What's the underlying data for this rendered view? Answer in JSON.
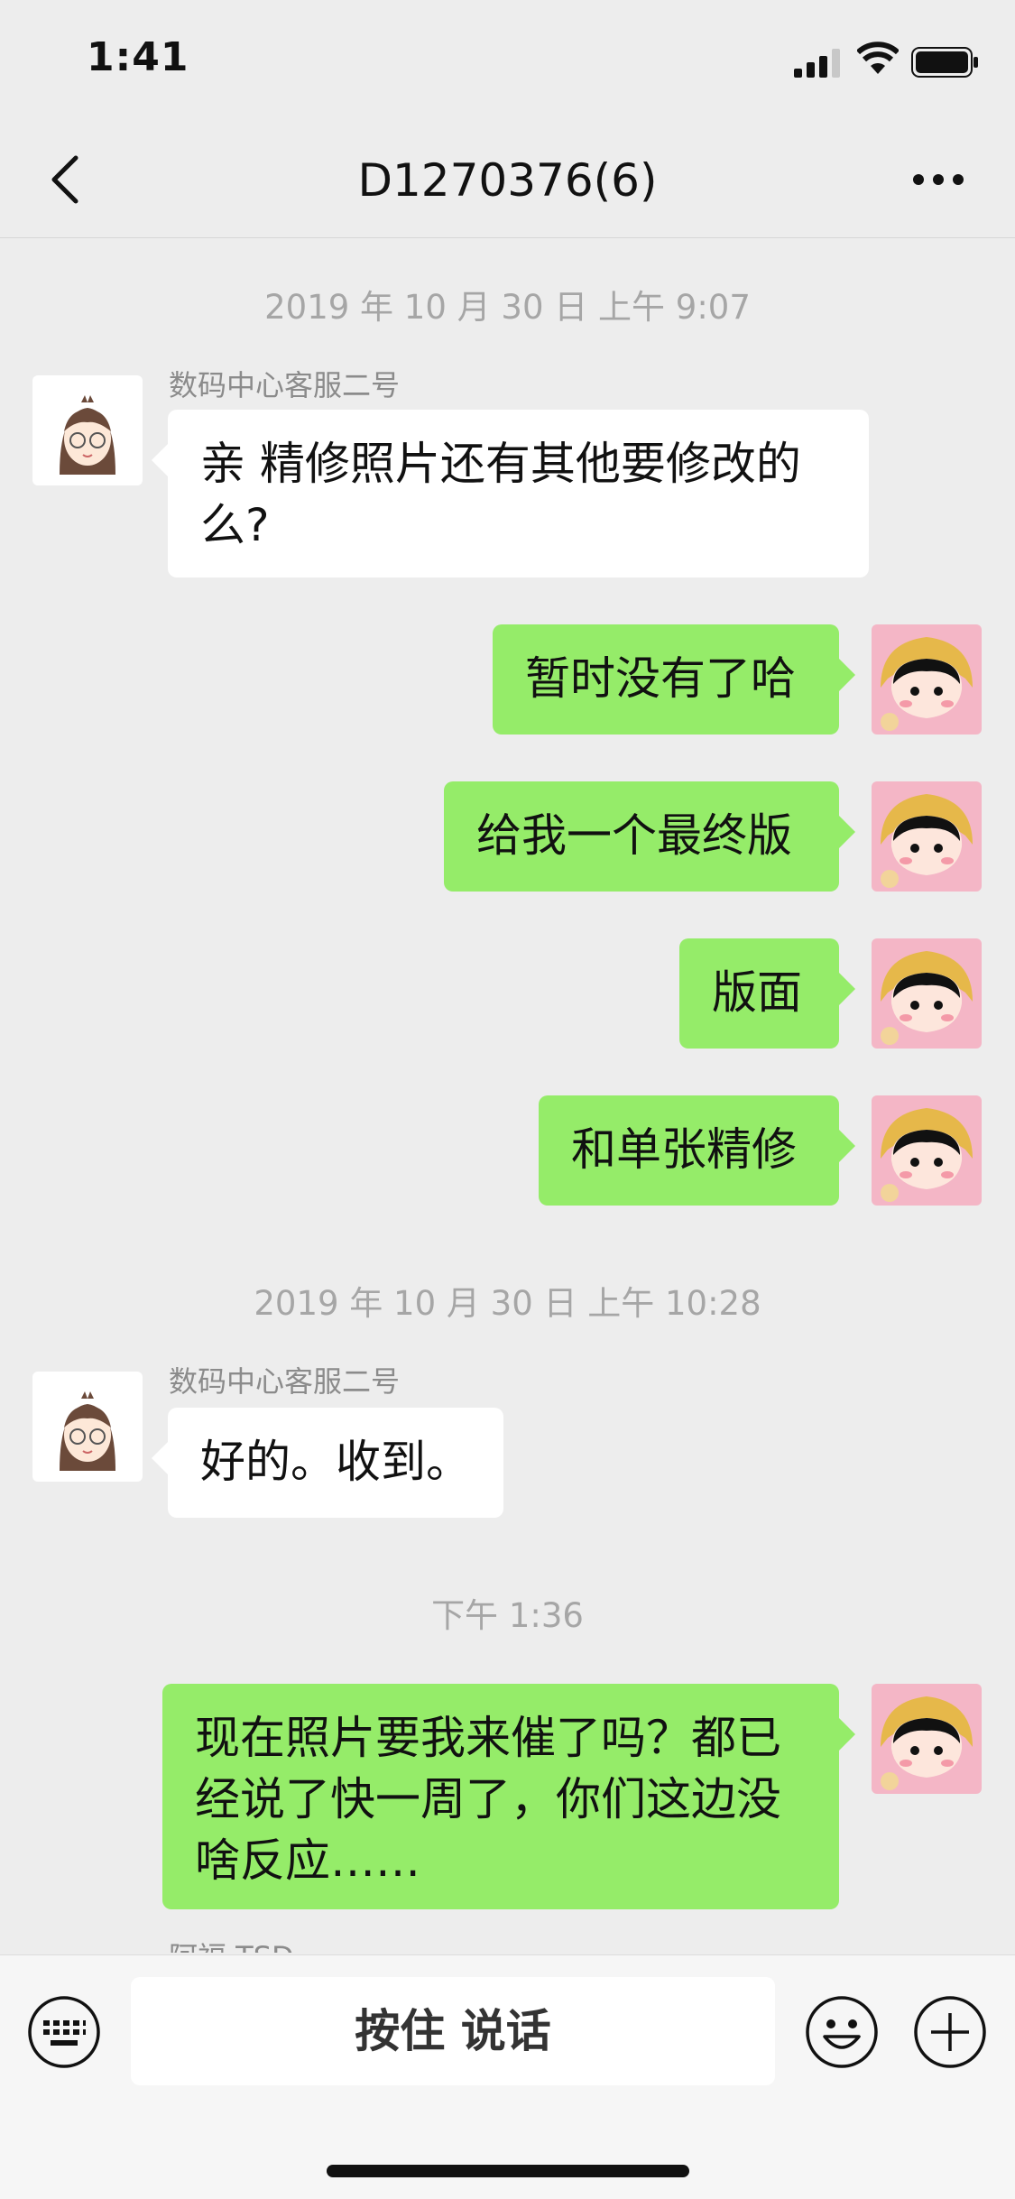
{
  "status": {
    "time": "1:41"
  },
  "nav": {
    "title": "D1270376(6)"
  },
  "messages": {
    "ts1": "2019 年 10 月 30 日 上午 9:07",
    "m1_sender": "数码中心客服二号",
    "m1_line1": "亲  精修照片还有其他要修改的",
    "m1_line2": "么?",
    "m2": "暂时没有了哈",
    "m3": "给我一个最终版",
    "m4": "版面",
    "m5": "和单张精修",
    "ts2": "2019 年 10 月 30 日 上午 10:28",
    "m6_sender": "数码中心客服二号",
    "m6": "好的。收到。",
    "ts3": "下午 1:36",
    "m7_line1": "现在照片要我来催了吗？都已",
    "m7_line2": "经说了快一周了，你们这边没",
    "m7_line3": "啥反应……",
    "partial_sender": "阿福 TSD"
  },
  "input": {
    "voice_label": "按住 说话"
  },
  "colors": {
    "bubble_out": "#95ec69",
    "bubble_in": "#ffffff",
    "background": "#ededed"
  },
  "icons": [
    "back-icon",
    "more-icon",
    "keyboard-icon",
    "emoji-icon",
    "plus-icon",
    "signal-icon",
    "wifi-icon",
    "battery-icon"
  ]
}
